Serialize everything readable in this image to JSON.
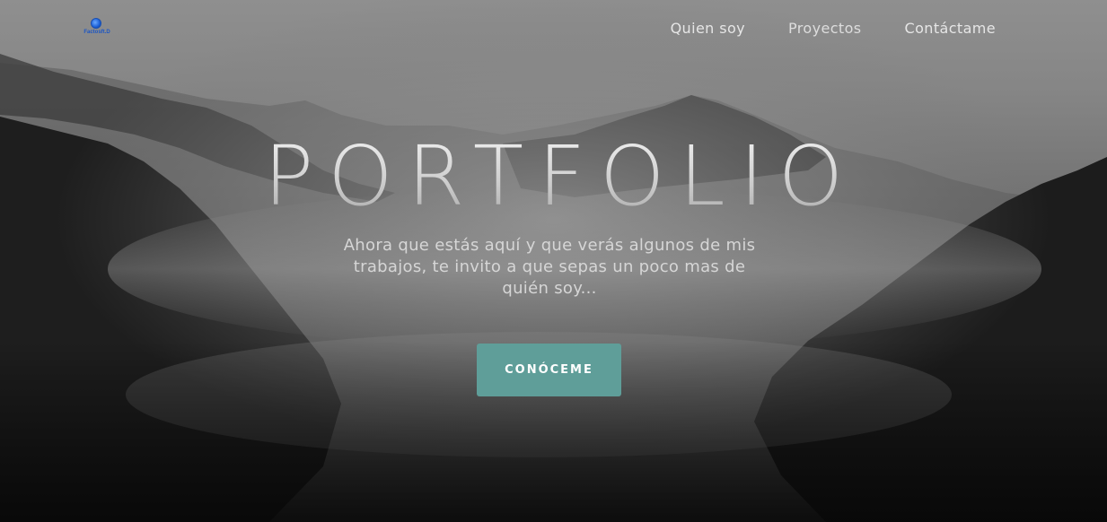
{
  "header": {
    "logo_text": "Factosft.D",
    "nav": [
      {
        "label": "Quien soy"
      },
      {
        "label": "Proyectos"
      },
      {
        "label": "Contáctame"
      }
    ]
  },
  "hero": {
    "title": "PORTFOLIO",
    "subtitle": "Ahora que estás aquí y que verás algunos de mis trabajos, te invito a que sepas un poco mas de quién soy...",
    "cta_label": "CONÓCEME"
  },
  "colors": {
    "accent": "#5f9e99",
    "logo_blue": "#1c56c4"
  }
}
